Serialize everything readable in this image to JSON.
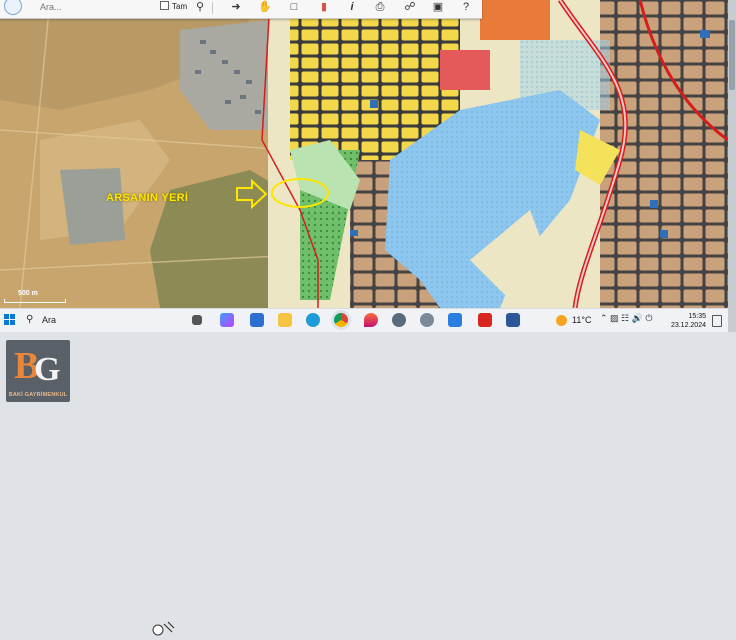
{
  "toolbar": {
    "search_placeholder": "Ara...",
    "checkbox_label": "Tam",
    "tools": [
      "search-icon",
      "arrow-icon",
      "hand-icon",
      "select-icon",
      "ruler-icon",
      "info-icon",
      "print-icon",
      "globe-icon",
      "image-icon",
      "help-icon"
    ]
  },
  "map": {
    "annotation_label": "ARSANIN YERİ",
    "scale_label": "500 m",
    "colors": {
      "parcel_red": "#d41e1e",
      "highlight_yellow": "#ffe500",
      "residential": "#f2d84a",
      "water": "#8dc6ee"
    }
  },
  "taskbar": {
    "search_text": "Ara",
    "weather": "11°C",
    "time": "15:35",
    "date": "23.12.2024",
    "apps": [
      "task-view",
      "copilot",
      "file-explorer",
      "edge",
      "chrome",
      "app-drop",
      "app-globe",
      "app-feather",
      "app-store",
      "acrobat",
      "word"
    ]
  },
  "branding": {
    "logo_caption": "BAKİ GAYRİMENKUL"
  }
}
